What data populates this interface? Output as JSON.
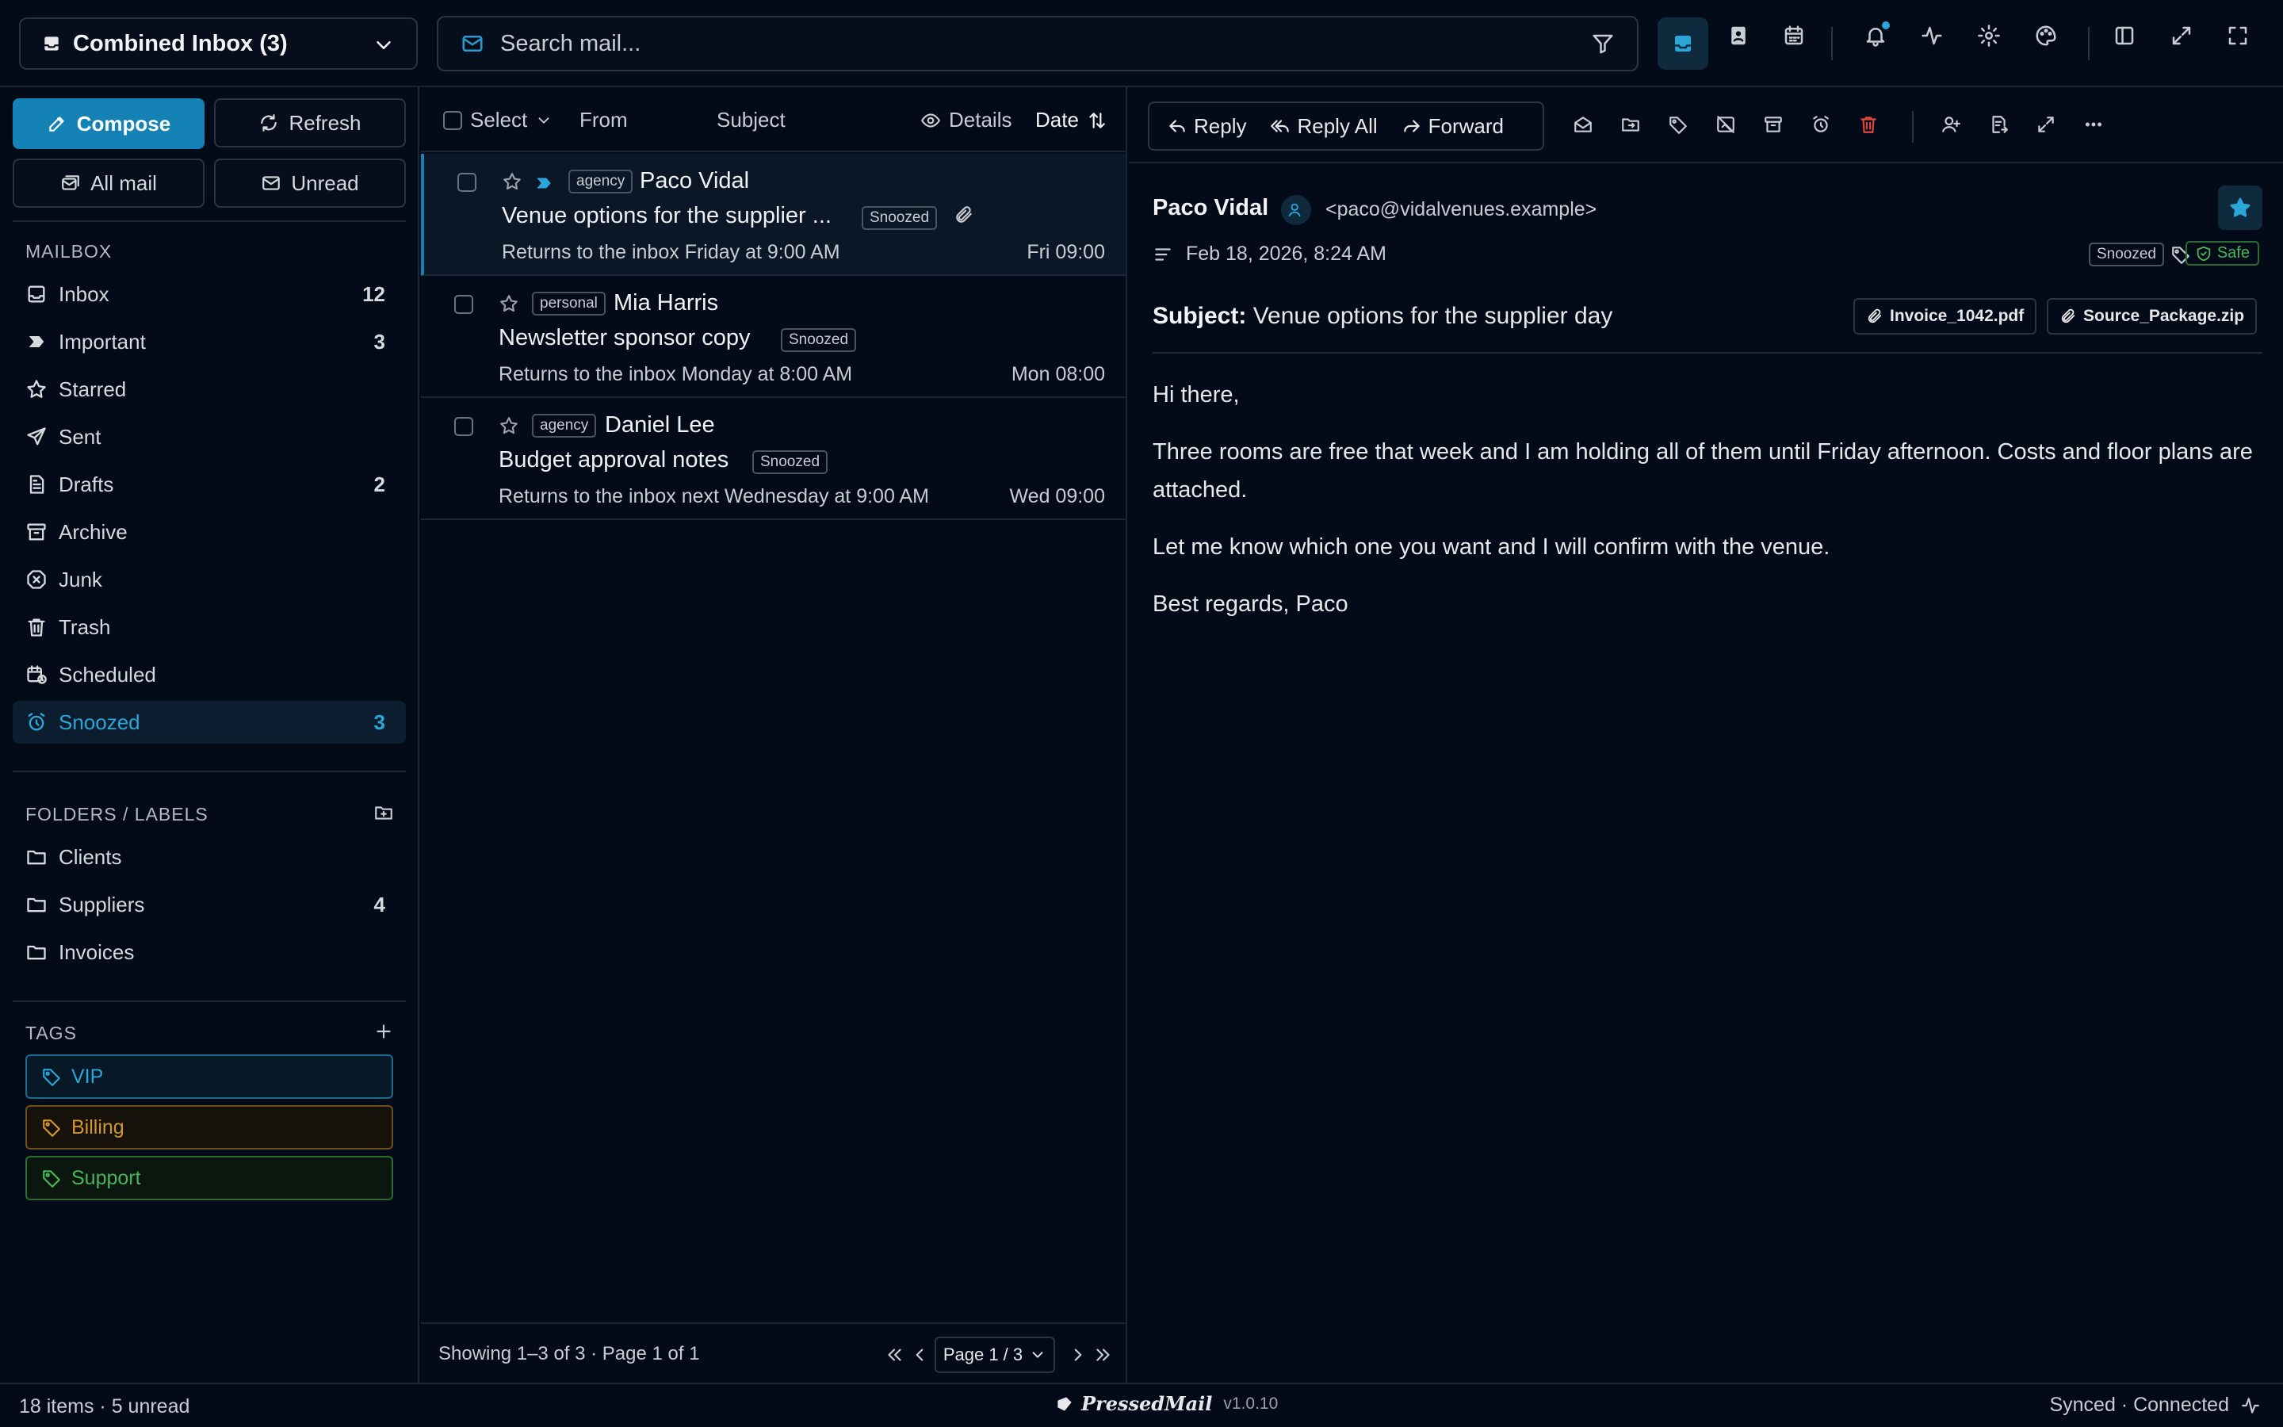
{
  "header": {
    "inbox_selector": "Combined Inbox (3)",
    "search_placeholder": "Search mail..."
  },
  "sidebar": {
    "compose": "Compose",
    "refresh": "Refresh",
    "all_mail": "All mail",
    "unread": "Unread",
    "mailbox_title": "MAILBOX",
    "mailbox": [
      {
        "label": "Inbox",
        "count": "12",
        "icon": "inbox-icon"
      },
      {
        "label": "Important",
        "count": "3",
        "icon": "important-icon"
      },
      {
        "label": "Starred",
        "count": "",
        "icon": "star-icon"
      },
      {
        "label": "Sent",
        "count": "",
        "icon": "send-icon"
      },
      {
        "label": "Drafts",
        "count": "2",
        "icon": "draft-icon"
      },
      {
        "label": "Archive",
        "count": "",
        "icon": "archive-icon"
      },
      {
        "label": "Junk",
        "count": "",
        "icon": "junk-icon"
      },
      {
        "label": "Trash",
        "count": "",
        "icon": "trash-icon"
      },
      {
        "label": "Scheduled",
        "count": "",
        "icon": "scheduled-icon"
      },
      {
        "label": "Snoozed",
        "count": "3",
        "icon": "alarm-icon",
        "active": true
      }
    ],
    "folders_title": "FOLDERS / LABELS",
    "folders": [
      {
        "label": "Clients",
        "count": ""
      },
      {
        "label": "Suppliers",
        "count": "4"
      },
      {
        "label": "Invoices",
        "count": ""
      }
    ],
    "tags_title": "TAGS",
    "tags": [
      {
        "label": "VIP",
        "color": "#2aa6d9"
      },
      {
        "label": "Billing",
        "color": "#d39530"
      },
      {
        "label": "Support",
        "color": "#49b55a"
      }
    ]
  },
  "list": {
    "select_label": "Select",
    "col_from": "From",
    "col_subject": "Subject",
    "details_label": "Details",
    "date_label": "Date",
    "messages": [
      {
        "label": "agency",
        "sender": "Paco Vidal",
        "subject": "Venue options for the supplier ...",
        "status": "Snoozed",
        "note": "Returns to the inbox Friday at 9:00 AM",
        "time": "Fri 09:00",
        "attachment": true,
        "important": true
      },
      {
        "label": "personal",
        "sender": "Mia Harris",
        "subject": "Newsletter sponsor copy",
        "status": "Snoozed",
        "note": "Returns to the inbox Monday at 8:00 AM",
        "time": "Mon 08:00"
      },
      {
        "label": "agency",
        "sender": "Daniel Lee",
        "subject": "Budget approval notes",
        "status": "Snoozed",
        "note": "Returns to the inbox next Wednesday at 9:00 AM",
        "time": "Wed 09:00"
      }
    ],
    "footer_text": "Showing 1–3 of 3 · Page 1 of 1",
    "page_select": "Page 1 / 3"
  },
  "reader": {
    "reply": "Reply",
    "reply_all": "Reply All",
    "forward": "Forward",
    "from_name": "Paco Vidal",
    "from_email": "<paco@vidalvenues.example>",
    "date": "Feb 18, 2026, 8:24 AM",
    "status": "Snoozed",
    "safe": "Safe",
    "subject_label": "Subject:",
    "subject": "Venue options for the supplier day",
    "attachments": [
      "Invoice_1042.pdf",
      "Source_Package.zip"
    ],
    "body": [
      "Hi there,",
      "Three rooms are free that week and I am holding all of them until Friday afternoon. Costs and floor plans are attached.",
      "Let me know which one you want and I will confirm with the venue.",
      "Best regards, Paco"
    ]
  },
  "status_bar": {
    "left": "18 items · 5 unread",
    "brand": "PressedMail",
    "version": "v1.0.10",
    "right": "Synced · Connected"
  },
  "colors": {
    "accent": "#1582b5",
    "background": "#030a18",
    "danger": "#e0473c"
  }
}
